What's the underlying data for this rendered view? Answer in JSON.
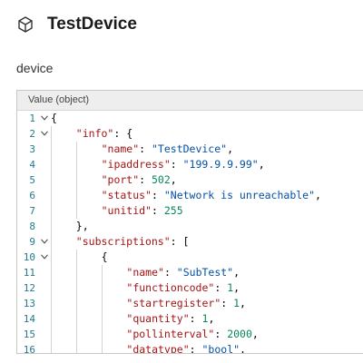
{
  "header": {
    "title": "TestDevice",
    "icon": "cube-icon"
  },
  "device_label": "device",
  "editor": {
    "header_label": "Value (object)",
    "lines": [
      {
        "n": "1",
        "indent": 0,
        "fold": true,
        "tokens": [
          {
            "t": "p",
            "v": "{"
          }
        ]
      },
      {
        "n": "2",
        "indent": 1,
        "fold": true,
        "tokens": [
          {
            "t": "k",
            "v": "\"info\""
          },
          {
            "t": "p",
            "v": ": {"
          }
        ]
      },
      {
        "n": "3",
        "indent": 2,
        "fold": false,
        "tokens": [
          {
            "t": "k",
            "v": "\"name\""
          },
          {
            "t": "p",
            "v": ": "
          },
          {
            "t": "s",
            "v": "\"TestDevice\""
          },
          {
            "t": "p",
            "v": ","
          }
        ]
      },
      {
        "n": "4",
        "indent": 2,
        "fold": false,
        "tokens": [
          {
            "t": "k",
            "v": "\"ipaddress\""
          },
          {
            "t": "p",
            "v": ": "
          },
          {
            "t": "s",
            "v": "\"199.9.9.99\""
          },
          {
            "t": "p",
            "v": ","
          }
        ]
      },
      {
        "n": "5",
        "indent": 2,
        "fold": false,
        "tokens": [
          {
            "t": "k",
            "v": "\"port\""
          },
          {
            "t": "p",
            "v": ": "
          },
          {
            "t": "n",
            "v": "502"
          },
          {
            "t": "p",
            "v": ","
          }
        ]
      },
      {
        "n": "6",
        "indent": 2,
        "fold": false,
        "tokens": [
          {
            "t": "k",
            "v": "\"status\""
          },
          {
            "t": "p",
            "v": ": "
          },
          {
            "t": "s",
            "v": "\"Network is unreachable\""
          },
          {
            "t": "p",
            "v": ","
          }
        ]
      },
      {
        "n": "7",
        "indent": 2,
        "fold": false,
        "tokens": [
          {
            "t": "k",
            "v": "\"unitid\""
          },
          {
            "t": "p",
            "v": ": "
          },
          {
            "t": "n",
            "v": "255"
          }
        ]
      },
      {
        "n": "8",
        "indent": 1,
        "fold": false,
        "tokens": [
          {
            "t": "p",
            "v": "},"
          }
        ]
      },
      {
        "n": "9",
        "indent": 1,
        "fold": true,
        "tokens": [
          {
            "t": "k",
            "v": "\"subscriptions\""
          },
          {
            "t": "p",
            "v": ": ["
          }
        ]
      },
      {
        "n": "10",
        "indent": 2,
        "fold": true,
        "tokens": [
          {
            "t": "p",
            "v": "{"
          }
        ]
      },
      {
        "n": "11",
        "indent": 3,
        "fold": false,
        "tokens": [
          {
            "t": "k",
            "v": "\"name\""
          },
          {
            "t": "p",
            "v": ": "
          },
          {
            "t": "s",
            "v": "\"SubTest\""
          },
          {
            "t": "p",
            "v": ","
          }
        ]
      },
      {
        "n": "12",
        "indent": 3,
        "fold": false,
        "tokens": [
          {
            "t": "k",
            "v": "\"functioncode\""
          },
          {
            "t": "p",
            "v": ": "
          },
          {
            "t": "n",
            "v": "1"
          },
          {
            "t": "p",
            "v": ","
          }
        ]
      },
      {
        "n": "13",
        "indent": 3,
        "fold": false,
        "tokens": [
          {
            "t": "k",
            "v": "\"startregister\""
          },
          {
            "t": "p",
            "v": ": "
          },
          {
            "t": "n",
            "v": "1"
          },
          {
            "t": "p",
            "v": ","
          }
        ]
      },
      {
        "n": "14",
        "indent": 3,
        "fold": false,
        "tokens": [
          {
            "t": "k",
            "v": "\"quantity\""
          },
          {
            "t": "p",
            "v": ": "
          },
          {
            "t": "n",
            "v": "1"
          },
          {
            "t": "p",
            "v": ","
          }
        ]
      },
      {
        "n": "15",
        "indent": 3,
        "fold": false,
        "tokens": [
          {
            "t": "k",
            "v": "\"pollinterval\""
          },
          {
            "t": "p",
            "v": ": "
          },
          {
            "t": "n",
            "v": "2000"
          },
          {
            "t": "p",
            "v": ","
          }
        ]
      },
      {
        "n": "16",
        "indent": 3,
        "fold": false,
        "tokens": [
          {
            "t": "k",
            "v": "\"datatype\""
          },
          {
            "t": "p",
            "v": ": "
          },
          {
            "t": "s",
            "v": "\"bool\""
          },
          {
            "t": "p",
            "v": ","
          }
        ]
      }
    ]
  }
}
